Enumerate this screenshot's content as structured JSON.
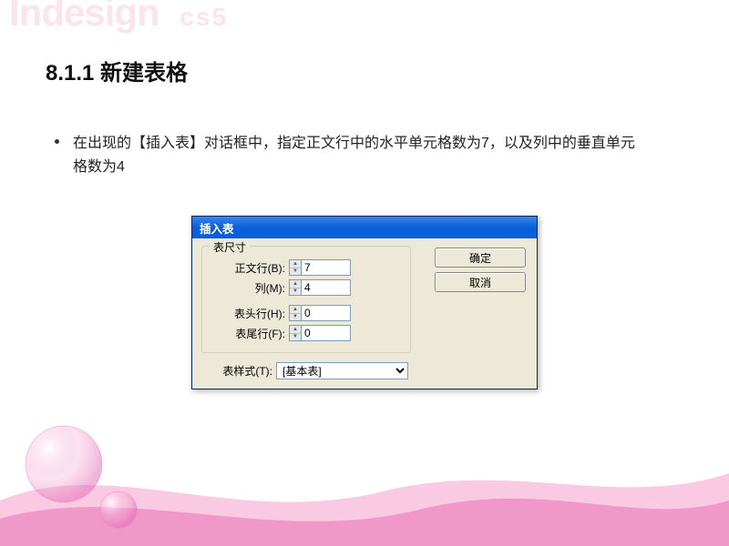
{
  "watermark": {
    "brand": "Indesign",
    "version": "cs5"
  },
  "heading": "8.1.1 新建表格",
  "bullet": "在出现的【插入表】对话框中，指定正文行中的水平单元格数为7，以及列中的垂直单元格数为4",
  "dialog": {
    "title": "插入表",
    "group_label": "表尺寸",
    "rows": {
      "body_rows": {
        "label": "正文行(B):",
        "value": "7"
      },
      "columns": {
        "label": "列(M):",
        "value": "4"
      },
      "header_rows": {
        "label": "表头行(H):",
        "value": "0"
      },
      "footer_rows": {
        "label": "表尾行(F):",
        "value": "0"
      }
    },
    "style": {
      "label": "表样式(T):",
      "value": "[基本表]"
    },
    "buttons": {
      "ok": "确定",
      "cancel": "取消"
    }
  }
}
